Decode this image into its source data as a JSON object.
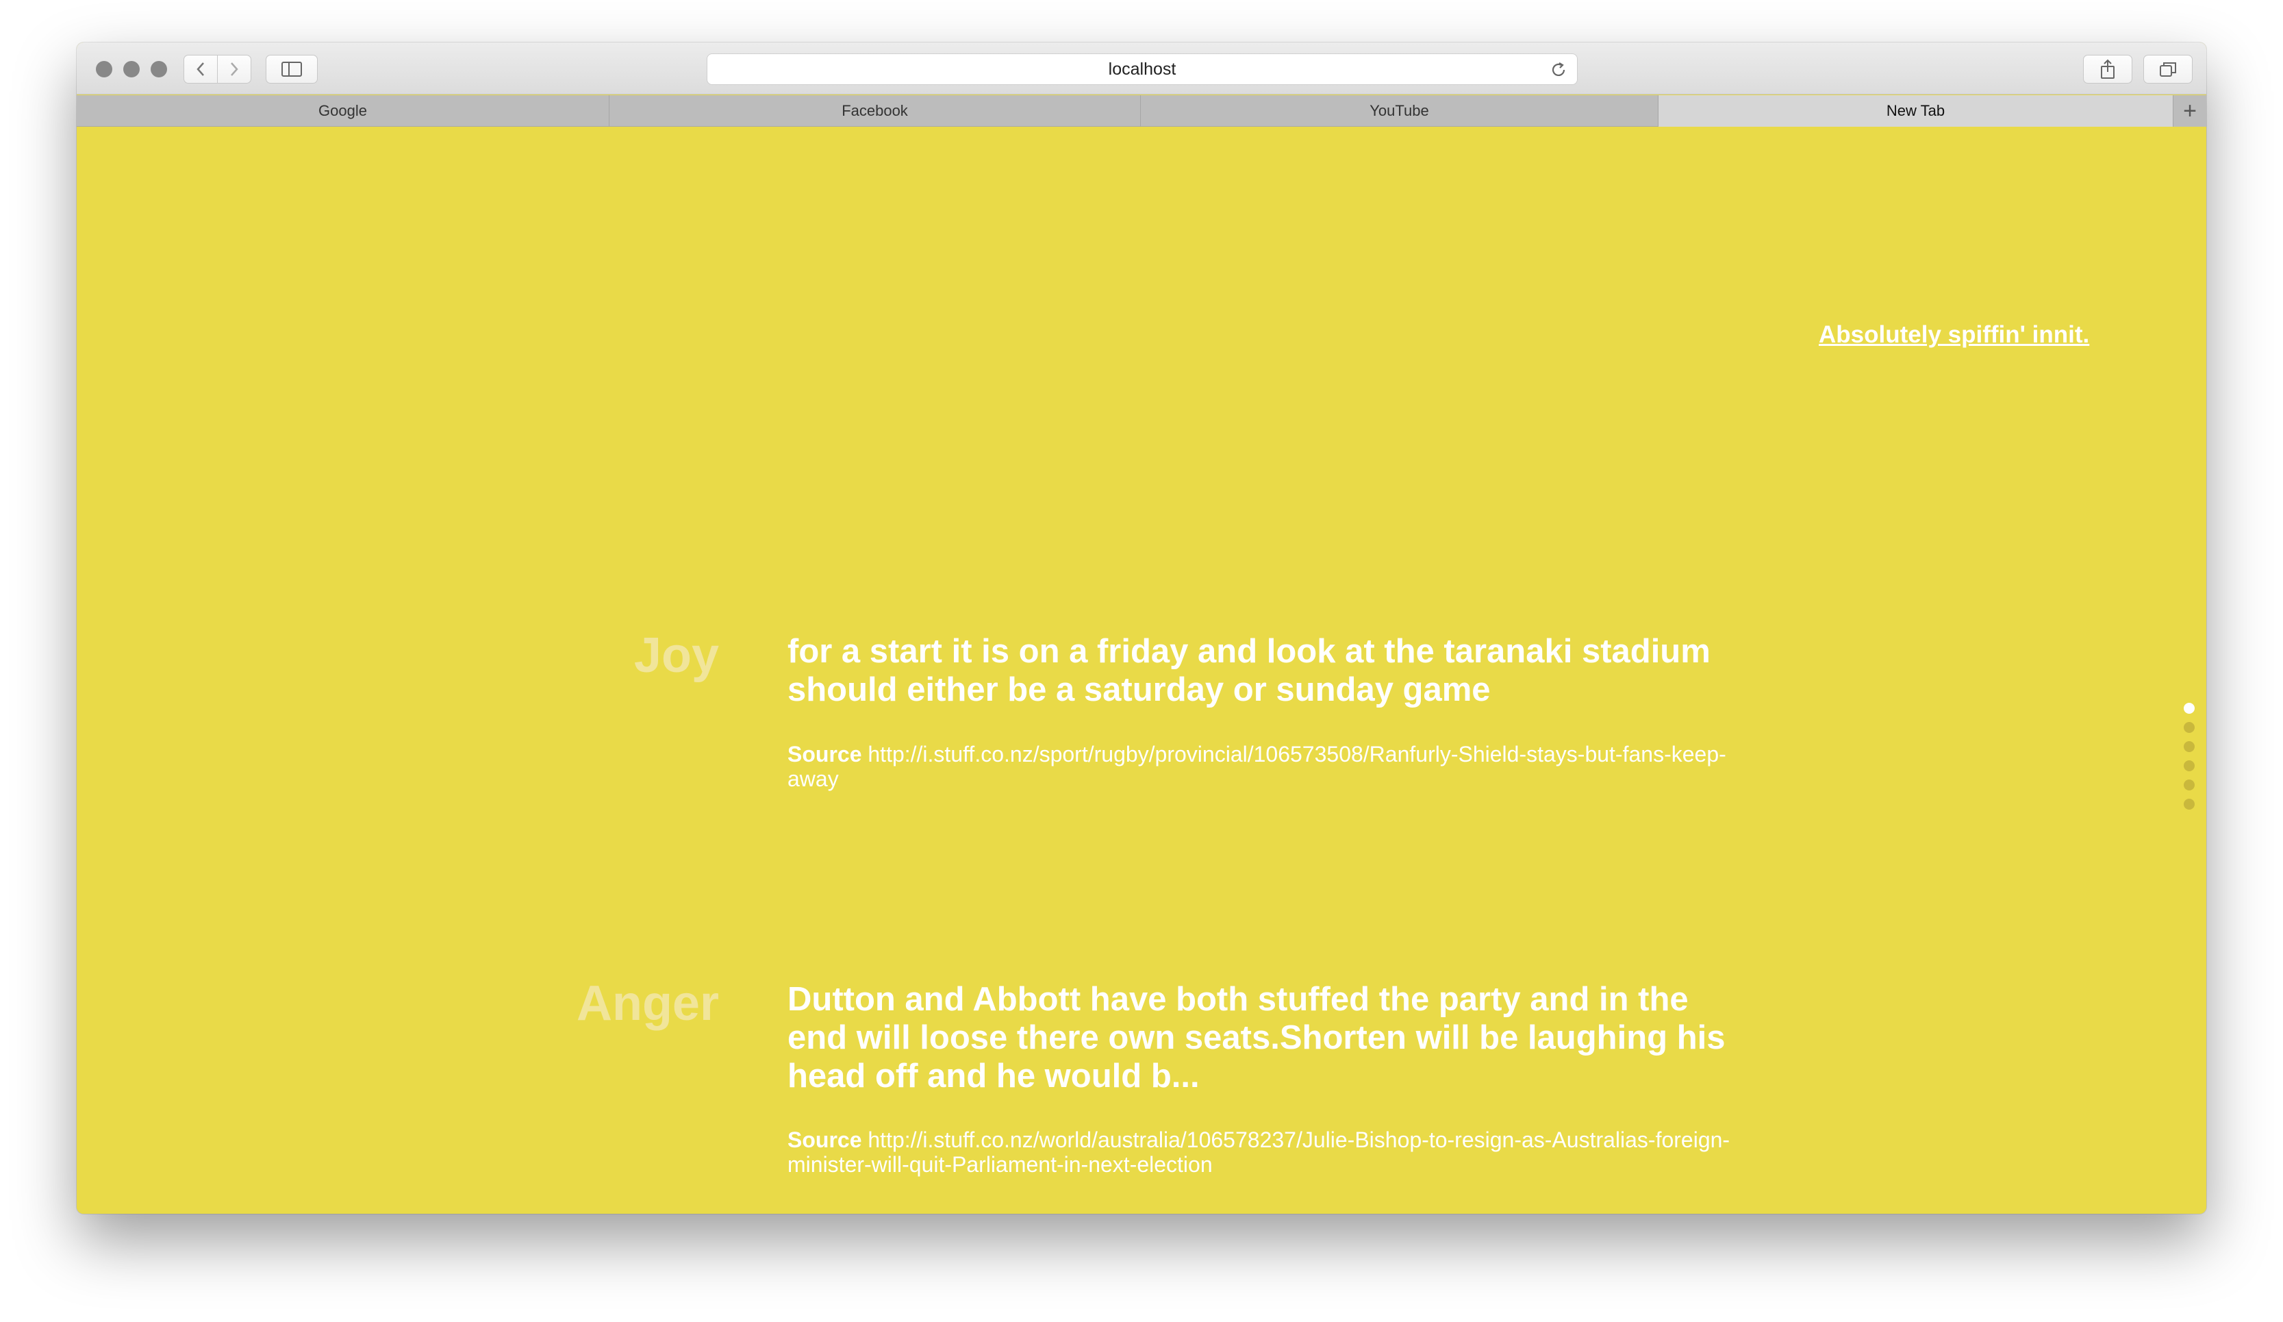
{
  "browser": {
    "url": "localhost",
    "tabs": [
      {
        "label": "Google",
        "active": false
      },
      {
        "label": "Facebook",
        "active": false
      },
      {
        "label": "YouTube",
        "active": false
      },
      {
        "label": "New Tab",
        "active": true
      }
    ],
    "new_tab_label": "+"
  },
  "page": {
    "background": "#e9da48",
    "top_link": "Absolutely spiffin' innit.",
    "entries": [
      {
        "emotion": "Joy",
        "quote": "for a start it is on a friday and look at the taranaki stadium should either be a saturday or sunday game",
        "source_label": "Source",
        "source_url": "http://i.stuff.co.nz/sport/rugby/provincial/106573508/Ranfurly-Shield-stays-but-fans-keep-away"
      },
      {
        "emotion": "Anger",
        "quote": "Dutton and Abbott have both stuffed the party and in the end will loose there own seats.Shorten will be laughing his head off and he would b...",
        "source_label": "Source",
        "source_url": "http://i.stuff.co.nz/world/australia/106578237/Julie-Bishop-to-resign-as-Australias-foreign-minister-will-quit-Parliament-in-next-election"
      }
    ],
    "pagination": {
      "total": 6,
      "active_index": 0
    }
  }
}
